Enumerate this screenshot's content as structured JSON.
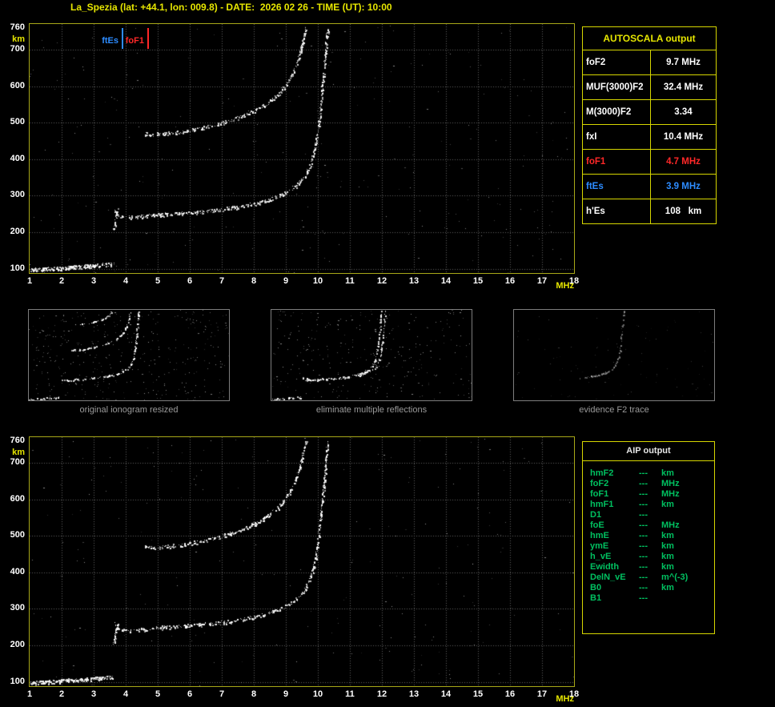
{
  "title": "La_Spezia (lat: +44.1, lon: 009.8) - DATE:  2026 02 26 - TIME (UT): 10:00",
  "autoscala_table": {
    "title": "AUTOSCALA output",
    "rows": [
      {
        "label": "foF2",
        "value": "9.7 MHz",
        "color": "white"
      },
      {
        "label": "MUF(3000)F2",
        "value": "32.4 MHz",
        "color": "white"
      },
      {
        "label": "M(3000)F2",
        "value": "3.34",
        "color": "white"
      },
      {
        "label": "fxI",
        "value": "10.4 MHz",
        "color": "white"
      },
      {
        "label": "foF1",
        "value": "4.7 MHz",
        "color": "red"
      },
      {
        "label": "ftEs",
        "value": "3.9 MHz",
        "color": "blue"
      },
      {
        "label": "h'Es",
        "value": "108   km",
        "color": "white"
      }
    ]
  },
  "aip_table": {
    "title": "AIP output",
    "rows": [
      {
        "name": "hmF2",
        "value": "---",
        "unit": "km"
      },
      {
        "name": "foF2",
        "value": "---",
        "unit": "MHz"
      },
      {
        "name": "foF1",
        "value": "---",
        "unit": "MHz"
      },
      {
        "name": "hmF1",
        "value": "---",
        "unit": "km"
      },
      {
        "name": "D1",
        "value": "---",
        "unit": ""
      },
      {
        "name": "foE",
        "value": "---",
        "unit": "MHz"
      },
      {
        "name": "hmE",
        "value": "---",
        "unit": "km"
      },
      {
        "name": "ymE",
        "value": "---",
        "unit": "km"
      },
      {
        "name": "h_vE",
        "value": "---",
        "unit": "km"
      },
      {
        "name": "Ewidth",
        "value": "---",
        "unit": "km"
      },
      {
        "name": "DelN_vE",
        "value": "---",
        "unit": "m^(-3)"
      },
      {
        "name": "B0",
        "value": "---",
        "unit": "km"
      },
      {
        "name": "B1",
        "value": "---",
        "unit": ""
      }
    ]
  },
  "markers": [
    {
      "id": "ftEs",
      "label": "ftEs",
      "freq": 3.9,
      "color": "#2d8cff"
    },
    {
      "id": "foF1",
      "label": "foF1",
      "freq": 4.7,
      "color": "#ff2828"
    }
  ],
  "thumbnails": [
    {
      "caption": "original ionogram resized",
      "traces": [
        "es",
        "f_trace",
        "second_hop",
        "third_hop"
      ],
      "noise": 380,
      "dim": false
    },
    {
      "caption": "eliminate multiple reflections",
      "traces": [
        "es",
        "f_trace",
        "f_trace_x"
      ],
      "noise": 300,
      "dim": false
    },
    {
      "caption": "evidence F2 trace",
      "traces": [
        "f2_part"
      ],
      "noise": 90,
      "dim": true
    }
  ],
  "chart_data": {
    "type": "scatter",
    "title": "Vertical incidence ionogram, La_Spezia, 2026-02-26 10:00 UT",
    "xlabel": "MHz",
    "ylabel": "km",
    "xlim": [
      1,
      18
    ],
    "ylim": [
      88,
      770
    ],
    "x_ticks": [
      1,
      2,
      3,
      4,
      5,
      6,
      7,
      8,
      9,
      10,
      11,
      12,
      13,
      14,
      15,
      16,
      17,
      18
    ],
    "y_ticks": [
      760,
      700,
      600,
      500,
      400,
      300,
      200,
      100
    ],
    "grid": true,
    "traces": {
      "es": [
        [
          1.0,
          97
        ],
        [
          1.4,
          99
        ],
        [
          1.8,
          101
        ],
        [
          2.2,
          104
        ],
        [
          2.6,
          106
        ],
        [
          3.0,
          109
        ],
        [
          3.3,
          111
        ],
        [
          3.6,
          113
        ]
      ],
      "f_spread": [
        [
          3.62,
          205
        ],
        [
          3.68,
          235
        ],
        [
          3.74,
          262
        ]
      ],
      "f_trace": [
        [
          3.65,
          262
        ],
        [
          3.75,
          246
        ],
        [
          4.0,
          241
        ],
        [
          4.3,
          241
        ],
        [
          4.7,
          246
        ],
        [
          5.0,
          248
        ],
        [
          5.5,
          251
        ],
        [
          6.0,
          254
        ],
        [
          6.5,
          258
        ],
        [
          7.0,
          263
        ],
        [
          7.5,
          269
        ],
        [
          8.0,
          277
        ],
        [
          8.4,
          287
        ],
        [
          8.8,
          299
        ],
        [
          9.1,
          313
        ],
        [
          9.4,
          333
        ],
        [
          9.6,
          356
        ],
        [
          9.75,
          383
        ],
        [
          9.87,
          416
        ],
        [
          9.95,
          453
        ],
        [
          10.02,
          496
        ],
        [
          10.08,
          546
        ],
        [
          10.14,
          601
        ],
        [
          10.2,
          661
        ],
        [
          10.25,
          716
        ],
        [
          10.3,
          760
        ]
      ],
      "second_hop": [
        [
          4.55,
          470
        ],
        [
          4.9,
          468
        ],
        [
          5.3,
          471
        ],
        [
          5.7,
          475
        ],
        [
          6.1,
          481
        ],
        [
          6.5,
          488
        ],
        [
          6.9,
          497
        ],
        [
          7.3,
          508
        ],
        [
          7.7,
          521
        ],
        [
          8.1,
          537
        ],
        [
          8.5,
          558
        ],
        [
          8.8,
          582
        ],
        [
          9.05,
          610
        ],
        [
          9.25,
          642
        ],
        [
          9.4,
          678
        ],
        [
          9.52,
          720
        ],
        [
          9.62,
          760
        ]
      ],
      "third_hop": [
        [
          4.9,
          655
        ],
        [
          5.6,
          662
        ],
        [
          6.3,
          674
        ],
        [
          6.9,
          690
        ],
        [
          7.4,
          710
        ],
        [
          7.8,
          735
        ],
        [
          8.0,
          755
        ]
      ],
      "f_trace_x": {
        "ref": "f_trace",
        "df": 0.35
      },
      "f2_part": {
        "ref": "f_trace",
        "fmin": 6.3
      }
    },
    "readings": {
      "foF2_MHz": 9.7,
      "MUF3000F2_MHz": 32.4,
      "M3000F2": 3.34,
      "fxI_MHz": 10.4,
      "foF1_MHz": 4.7,
      "ftEs_MHz": 3.9,
      "hEs_km": 108
    }
  }
}
